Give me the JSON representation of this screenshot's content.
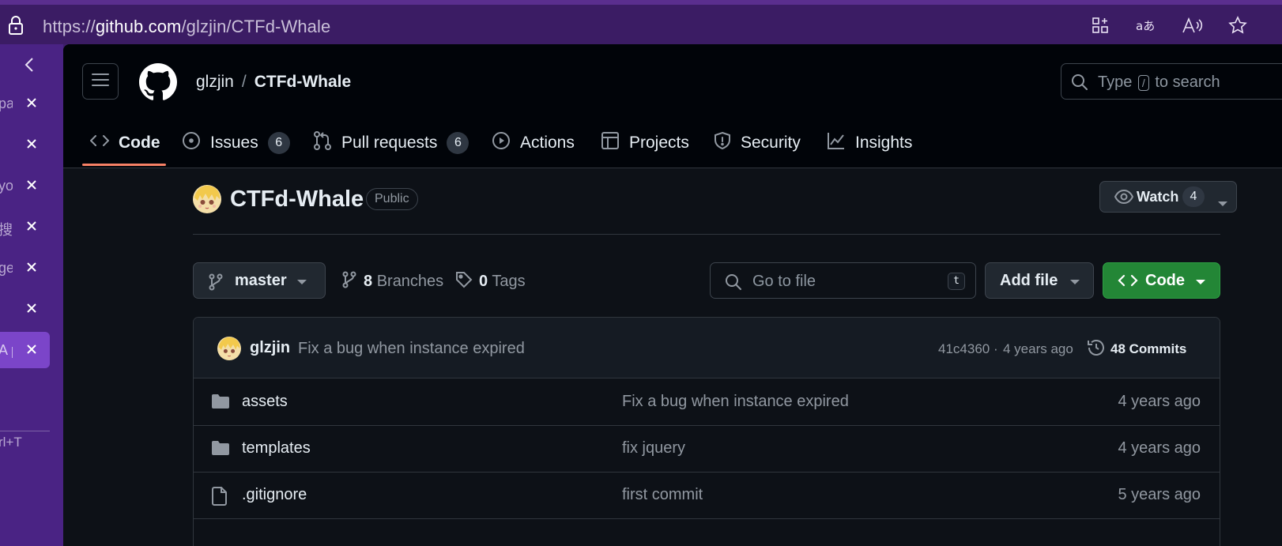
{
  "browser": {
    "url_scheme": "https://",
    "url_host": "github.com",
    "url_path": "/glzjin/CTFd-Whale",
    "toolbar_icons": [
      "app-available-icon",
      "translate-icon",
      "read-aloud-icon",
      "favorite-icon"
    ]
  },
  "tab_strip": {
    "tabs": [
      {
        "label": "pa",
        "active": false
      },
      {
        "label": "",
        "active": false
      },
      {
        "label": "yo",
        "active": false
      },
      {
        "label": "搜",
        "active": false
      },
      {
        "label": "ges",
        "active": false
      },
      {
        "label": "",
        "active": false
      },
      {
        "label": "A p",
        "active": true
      }
    ],
    "new_tab_hint": "rl+T"
  },
  "header": {
    "owner": "glzjin",
    "separator": "/",
    "repo": "CTFd-Whale",
    "search_prefix": "Type",
    "search_key": "/",
    "search_suffix": "to search"
  },
  "repo_nav": {
    "tabs": [
      {
        "label": "Code",
        "icon": "code-icon",
        "selected": true
      },
      {
        "label": "Issues",
        "icon": "issue-icon",
        "counter": "6"
      },
      {
        "label": "Pull requests",
        "icon": "pull-request-icon",
        "counter": "6"
      },
      {
        "label": "Actions",
        "icon": "play-icon"
      },
      {
        "label": "Projects",
        "icon": "table-icon"
      },
      {
        "label": "Security",
        "icon": "shield-icon"
      },
      {
        "label": "Insights",
        "icon": "graph-icon"
      }
    ]
  },
  "repo": {
    "name": "CTFd-Whale",
    "visibility": "Public",
    "watch_label": "Watch",
    "watch_count": "4"
  },
  "toolbar": {
    "branch": "master",
    "branches_count": "8",
    "branches_label": "Branches",
    "tags_count": "0",
    "tags_label": "Tags",
    "goto_placeholder": "Go to file",
    "goto_key": "t",
    "add_file_label": "Add file",
    "code_label": "Code"
  },
  "latest_commit": {
    "author": "glzjin",
    "message": "Fix a bug when instance expired",
    "hash": "41c4360",
    "dot": "·",
    "age": "4 years ago",
    "commits_label": "48 Commits"
  },
  "files": [
    {
      "name": "assets",
      "type": "folder",
      "message": "Fix a bug when instance expired",
      "age": "4 years ago"
    },
    {
      "name": "templates",
      "type": "folder",
      "message": "fix jquery",
      "age": "4 years ago"
    },
    {
      "name": ".gitignore",
      "type": "file",
      "message": "first commit",
      "age": "5 years ago"
    }
  ],
  "colors": {
    "page_bg": "#0d1117",
    "header_bg": "#010409",
    "accent_tab": "#f78166",
    "code_button": "#238636",
    "browser_frame": "#4a2384"
  }
}
